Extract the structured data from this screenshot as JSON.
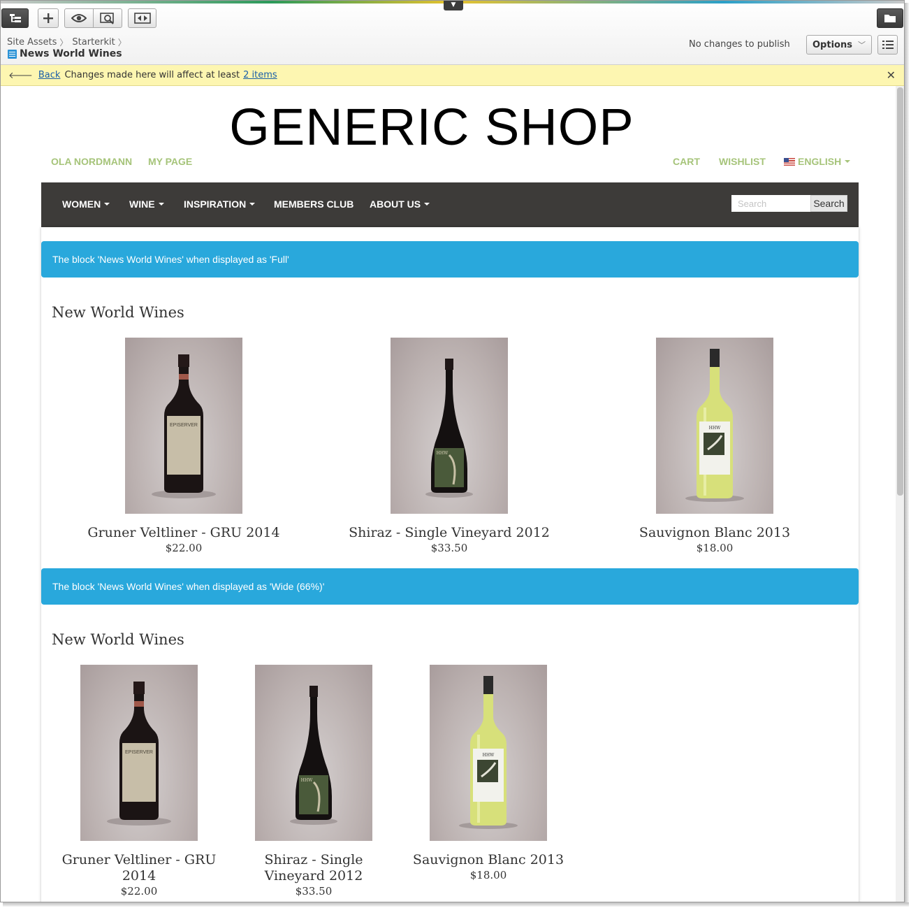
{
  "toolbar": {
    "breadcrumb": [
      "Site Assets",
      "Starterkit"
    ],
    "page_title": "News World Wines",
    "publish_status": "No changes to publish",
    "options_label": "Options"
  },
  "notice": {
    "back_label": "Back",
    "message": "Changes made here will affect at least",
    "items_link": "2 items"
  },
  "site": {
    "title": "GENERIC SHOP",
    "util_left": [
      "OLA NORDMANN",
      "MY PAGE"
    ],
    "util_right": [
      "CART",
      "WISHLIST",
      "ENGLISH"
    ],
    "nav": [
      "WOMEN",
      "WINE",
      "INSPIRATION",
      "MEMBERS CLUB",
      "ABOUT US"
    ],
    "search_placeholder": "Search",
    "search_button": "Search"
  },
  "blocks": [
    {
      "banner": "The block 'News World Wines' when displayed as 'Full'",
      "heading": "New World Wines",
      "products": [
        {
          "name": "Gruner Veltliner - GRU 2014",
          "price": "$22.00"
        },
        {
          "name": "Shiraz - Single Vineyard 2012",
          "price": "$33.50"
        },
        {
          "name": "Sauvignon Blanc 2013",
          "price": "$18.00"
        }
      ]
    },
    {
      "banner": "The block 'News World Wines' when displayed as 'Wide (66%)'",
      "heading": "New World Wines",
      "products": [
        {
          "name": "Gruner Veltliner - GRU 2014",
          "price": "$22.00"
        },
        {
          "name": "Shiraz - Single Vineyard 2012",
          "price": "$33.50"
        },
        {
          "name": "Sauvignon Blanc 2013",
          "price": "$18.00"
        }
      ]
    }
  ],
  "bottle_labels": {
    "gruner": "EPISERVER",
    "shiraz": "HHW",
    "sauvignon": "HHW"
  },
  "colors": {
    "accent_link": "#a6c47a",
    "navbar": "#3d3b39",
    "banner": "#29a8dc",
    "notice": "#fdf6b1"
  }
}
